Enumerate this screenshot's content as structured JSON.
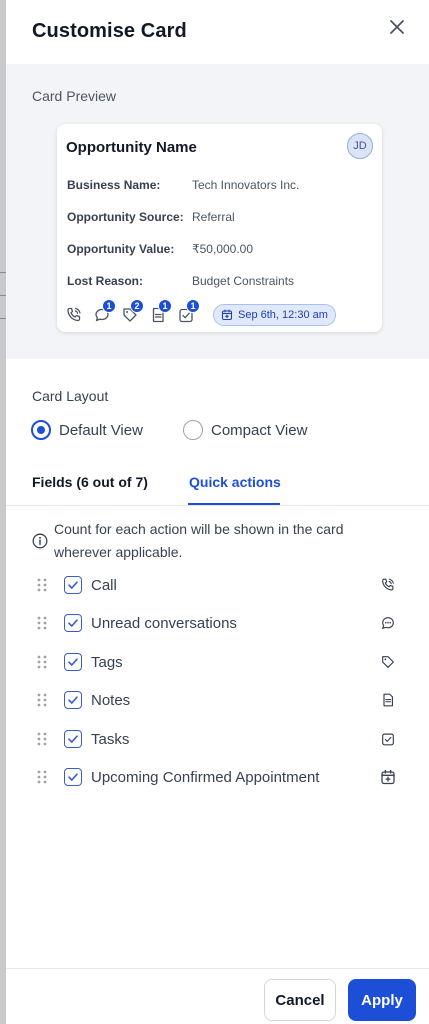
{
  "header": {
    "title": "Customise Card"
  },
  "preview": {
    "label": "Card Preview",
    "card": {
      "title": "Opportunity Name",
      "avatar_initials": "JD",
      "fields": [
        {
          "label": "Business Name:",
          "value": "Tech Innovators Inc."
        },
        {
          "label": "Opportunity Source:",
          "value": "Referral"
        },
        {
          "label": "Opportunity Value:",
          "value": "₹50,000.00"
        },
        {
          "label": "Lost Reason:",
          "value": "Budget Constraints"
        }
      ],
      "icons": [
        {
          "name": "call-icon",
          "badge": ""
        },
        {
          "name": "conversation-icon",
          "badge": "1"
        },
        {
          "name": "tag-icon",
          "badge": "2"
        },
        {
          "name": "note-icon",
          "badge": "1"
        },
        {
          "name": "task-icon",
          "badge": "1"
        }
      ],
      "appointment": "Sep 6th, 12:30 am"
    }
  },
  "layout": {
    "label": "Card Layout",
    "options": [
      {
        "label": "Default View",
        "selected": true
      },
      {
        "label": "Compact View",
        "selected": false
      }
    ]
  },
  "tabs": [
    {
      "label": "Fields (6 out of 7)",
      "active": false
    },
    {
      "label": "Quick actions",
      "active": true
    }
  ],
  "info": {
    "text": "Count for each action will be shown in the card wherever applicable."
  },
  "actions": [
    {
      "label": "Call",
      "checked": true,
      "icon": "call-icon"
    },
    {
      "label": "Unread conversations",
      "checked": true,
      "icon": "conversation-icon"
    },
    {
      "label": "Tags",
      "checked": true,
      "icon": "tag-icon"
    },
    {
      "label": "Notes",
      "checked": true,
      "icon": "note-icon"
    },
    {
      "label": "Tasks",
      "checked": true,
      "icon": "task-icon"
    },
    {
      "label": "Upcoming Confirmed Appointment",
      "checked": true,
      "icon": "calendar-icon"
    }
  ],
  "footer": {
    "cancel_label": "Cancel",
    "apply_label": "Apply"
  },
  "colors": {
    "accent": "#1d4ed8",
    "preview_bg": "#f2f4f7"
  }
}
